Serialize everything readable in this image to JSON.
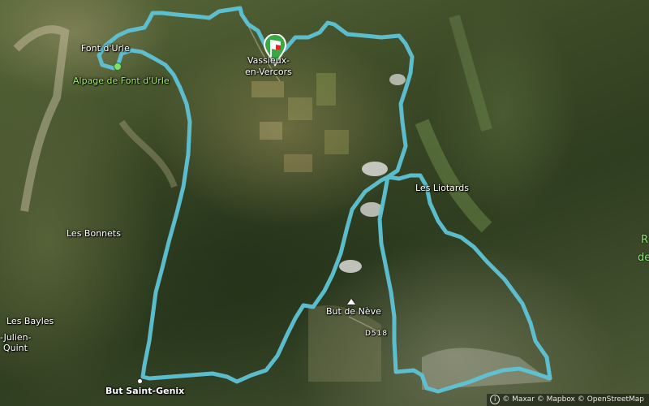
{
  "map": {
    "places": {
      "font_durle": "Font d'Urle",
      "alpage_font_durle": "Alpage de Font d'Urle",
      "vassieux_line1": "Vassieux-",
      "vassieux_line2": "en-Vercors",
      "les_liotards": "Les Liotards",
      "les_bonnets": "Les Bonnets",
      "les_bayles": "Les Bayles",
      "julien_quint_line1": "-Julien-",
      "julien_quint_line2": "Quint",
      "but_de_neve": "But de Nève",
      "road_d518": "D518",
      "but_saint_genix": "But Saint-Genix",
      "edge_r": "R",
      "edge_de": "de"
    },
    "route_color": "#5ec3d6",
    "start_marker": "start-finish-flag-icon",
    "summit_icon": "summit-triangle-icon",
    "attribution": {
      "info_glyph": "i",
      "text": "© Maxar © Mapbox © OpenStreetMap"
    }
  }
}
